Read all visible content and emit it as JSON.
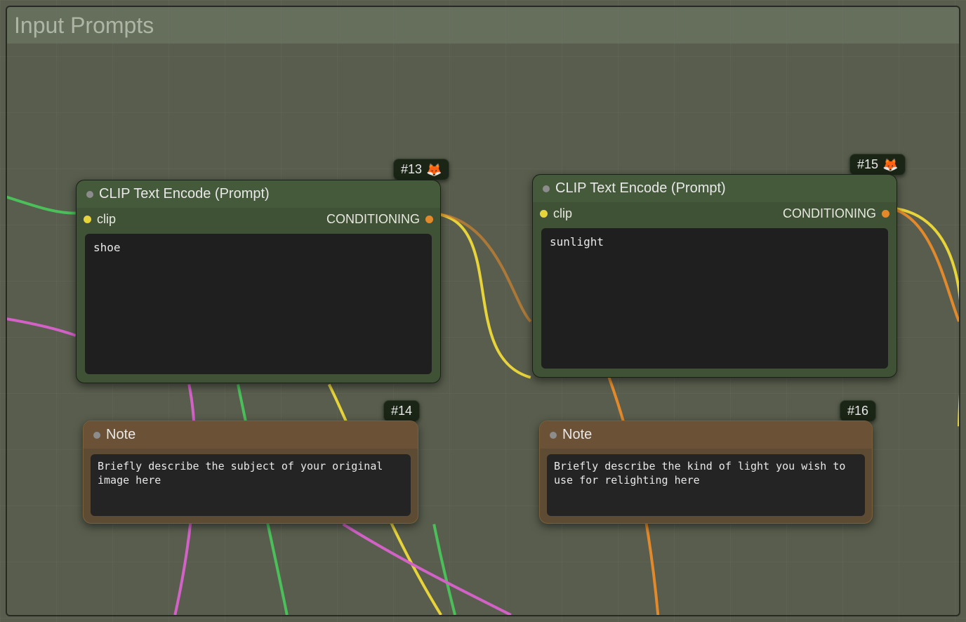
{
  "group": {
    "title": "Input Prompts"
  },
  "badges": {
    "n13": "#13",
    "n14": "#14",
    "n15": "#15",
    "n16": "#16",
    "fox": "🦊"
  },
  "node13": {
    "title": "CLIP Text Encode (Prompt)",
    "input_label": "clip",
    "output_label": "CONDITIONING",
    "text": "shoe"
  },
  "node15": {
    "title": "CLIP Text Encode (Prompt)",
    "input_label": "clip",
    "output_label": "CONDITIONING",
    "text": "sunlight"
  },
  "node14": {
    "title": "Note",
    "text": "Briefly describe the subject of your original image here"
  },
  "node16": {
    "title": "Note",
    "text": "Briefly describe the kind of light you wish to use for relighting here"
  }
}
